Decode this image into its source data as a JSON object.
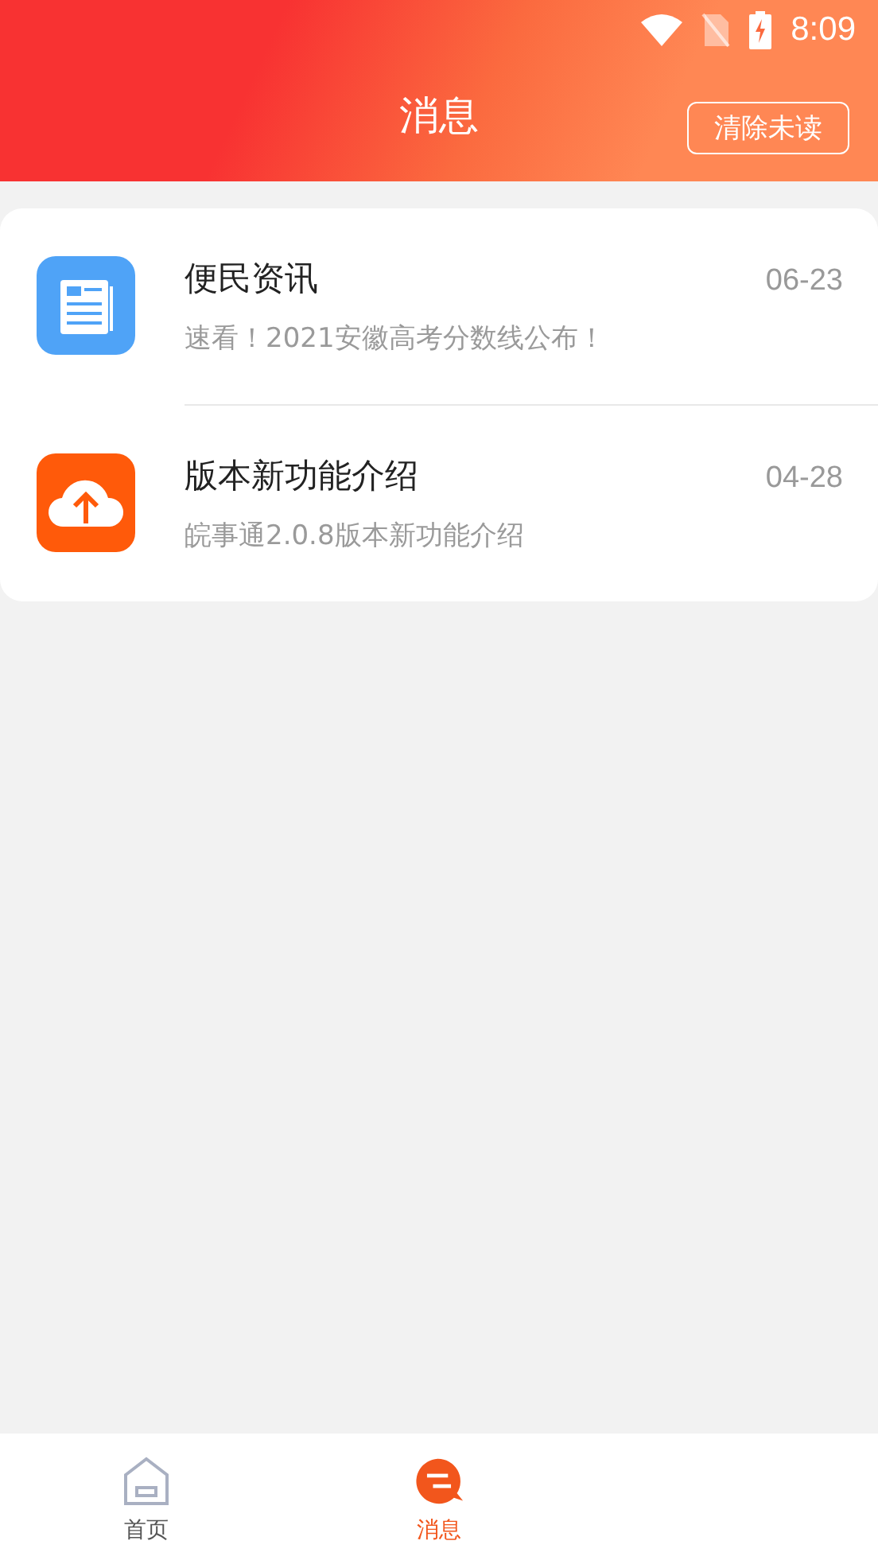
{
  "status_bar": {
    "time": "8:09"
  },
  "header": {
    "title": "消息",
    "action": "清除未读"
  },
  "messages": [
    {
      "kind": "news",
      "title": "便民资讯",
      "preview": "速看！2021安徽高考分数线公布！",
      "date": "06-23"
    },
    {
      "kind": "update",
      "title": "版本新功能介绍",
      "preview": "皖事通2.0.8版本新功能介绍",
      "date": "04-28"
    }
  ],
  "tabs": [
    {
      "kind": "home",
      "label": "首页",
      "selected": false
    },
    {
      "kind": "messages",
      "label": "消息",
      "selected": true
    }
  ]
}
